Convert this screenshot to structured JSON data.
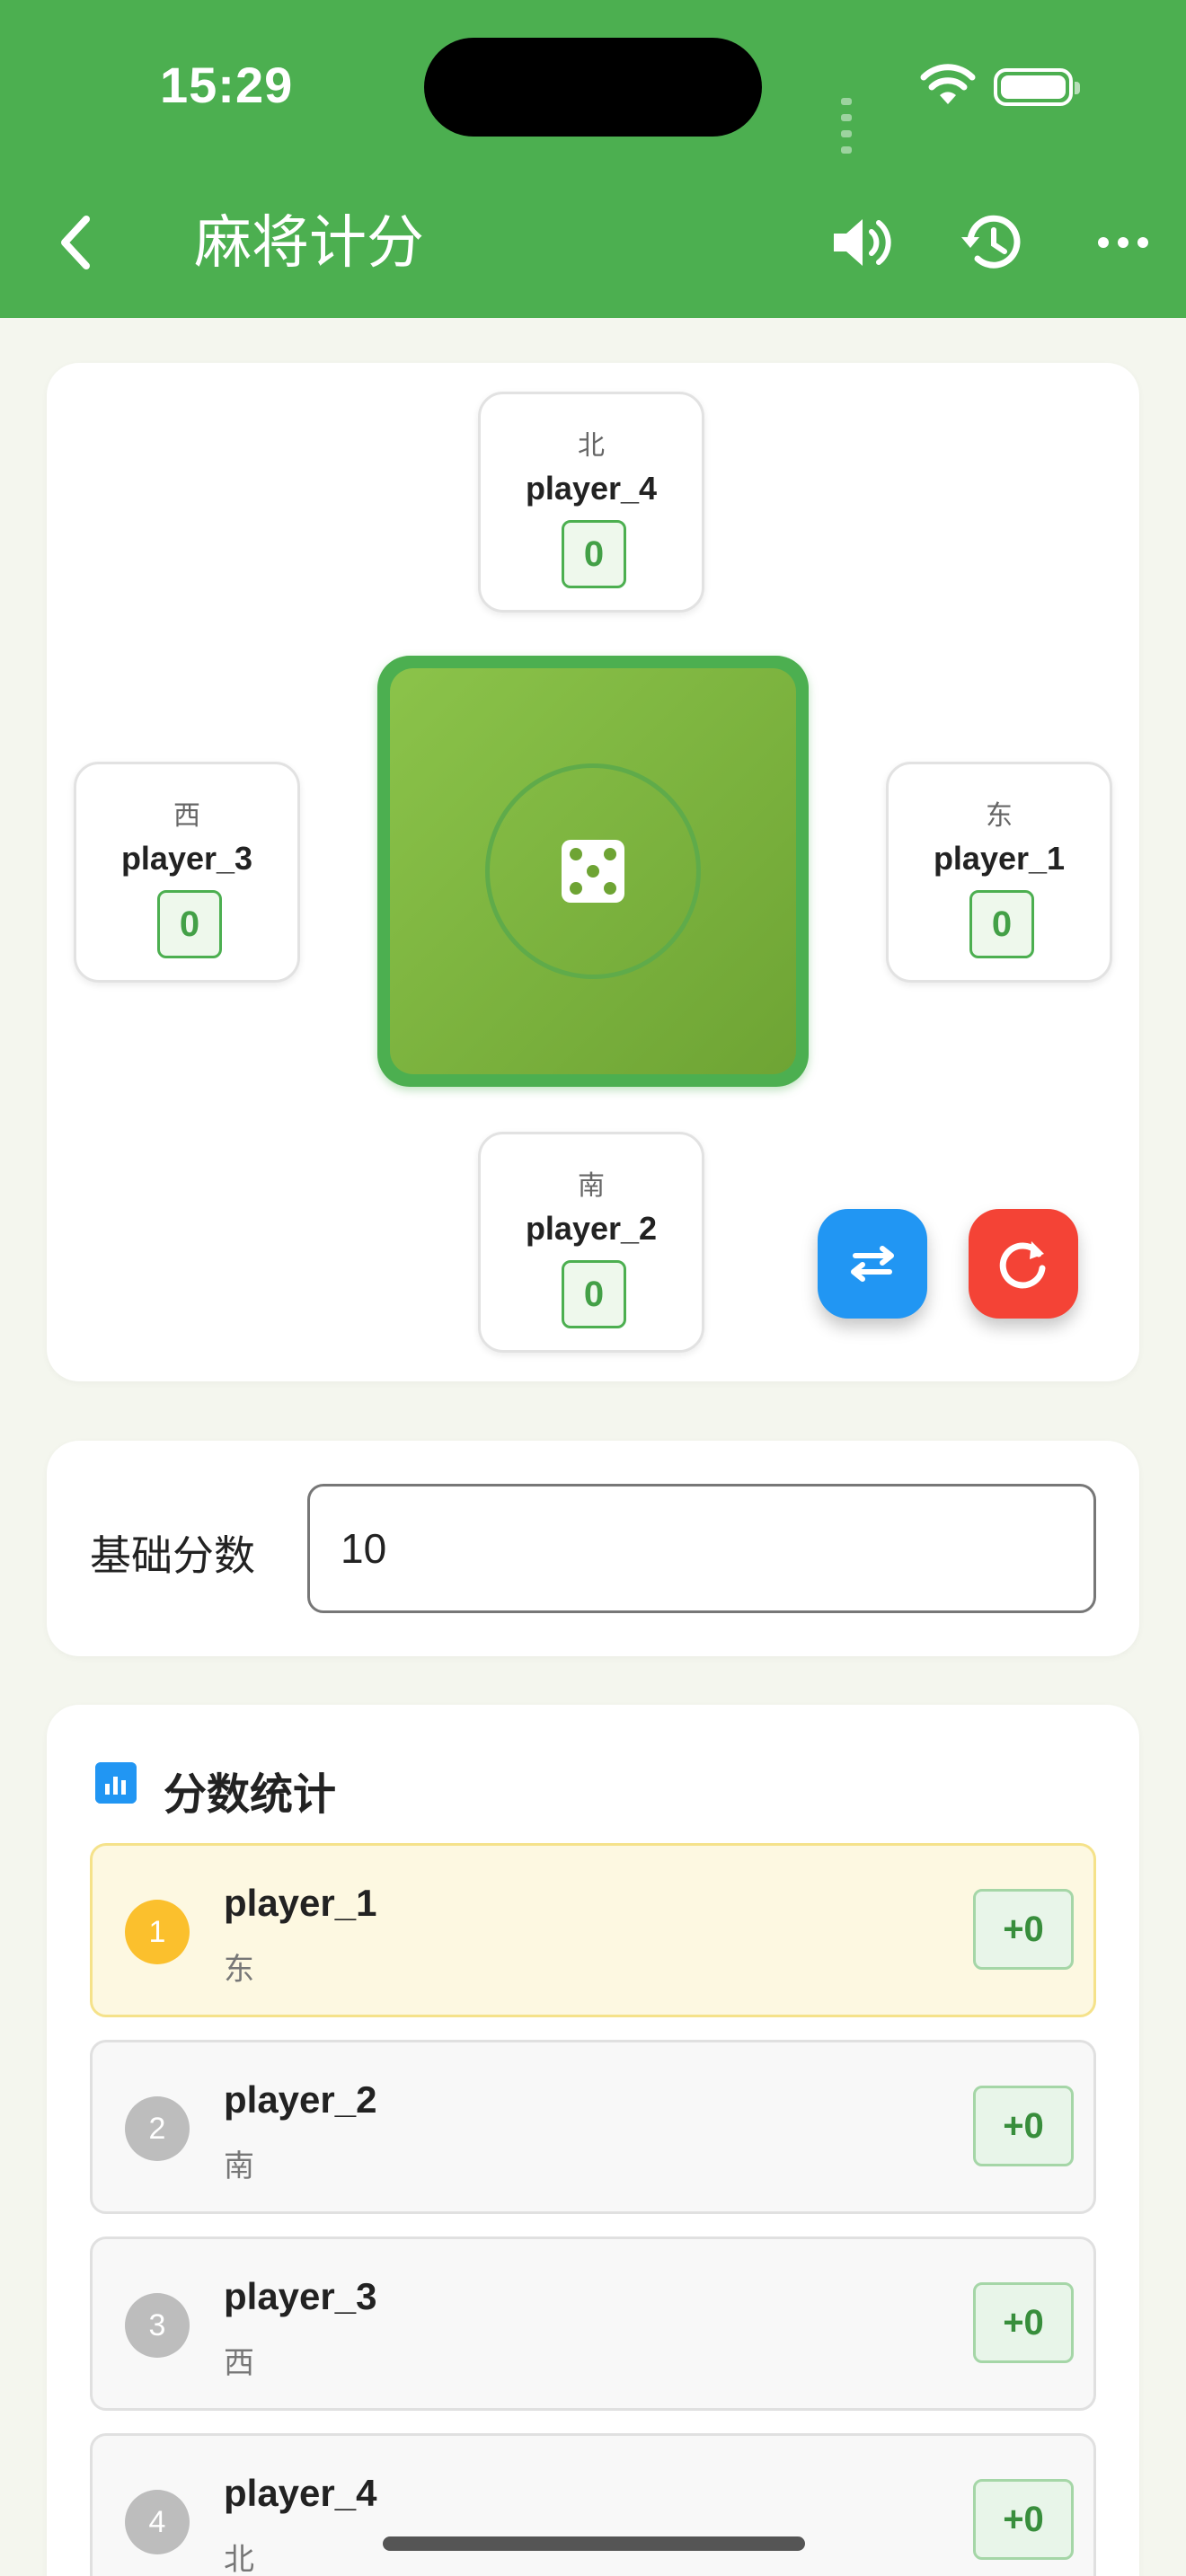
{
  "status_bar": {
    "time": "15:29"
  },
  "nav": {
    "title": "麻将计分"
  },
  "table": {
    "north": {
      "wind": "北",
      "name": "player_4",
      "score": "0"
    },
    "west": {
      "wind": "西",
      "name": "player_3",
      "score": "0"
    },
    "east": {
      "wind": "东",
      "name": "player_1",
      "score": "0"
    },
    "south": {
      "wind": "南",
      "name": "player_2",
      "score": "0"
    }
  },
  "base_score": {
    "label": "基础分数",
    "value": "10"
  },
  "stats": {
    "title": "分数统计",
    "rows": [
      {
        "rank": "1",
        "name": "player_1",
        "wind": "东",
        "score": "+0"
      },
      {
        "rank": "2",
        "name": "player_2",
        "wind": "南",
        "score": "+0"
      },
      {
        "rank": "3",
        "name": "player_3",
        "wind": "西",
        "score": "+0"
      },
      {
        "rank": "4",
        "name": "player_4",
        "wind": "北",
        "score": "+0"
      }
    ]
  },
  "colors": {
    "primary": "#4caf50",
    "swap_button": "#2196f3",
    "reset_button": "#f44336",
    "leader_rank": "#fbc02d"
  },
  "icons": [
    "back-icon",
    "sound-icon",
    "history-icon",
    "more-icon",
    "dice-icon",
    "swap-icon",
    "reset-icon",
    "bar-chart-icon"
  ]
}
